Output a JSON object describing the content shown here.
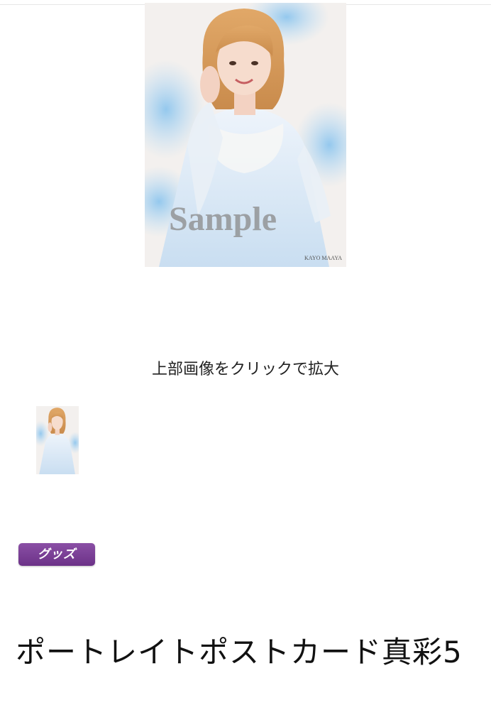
{
  "product": {
    "main_image": {
      "watermark": "Sample",
      "signature": "KAYO MAAYA"
    },
    "enlarge_caption": "上部画像をクリックで拡大",
    "category_badge": "グッズ",
    "title": "ポートレイトポストカード真彩5"
  },
  "colors": {
    "badge": "#7a3f96",
    "background": "#ffffff",
    "text": "#111111"
  }
}
